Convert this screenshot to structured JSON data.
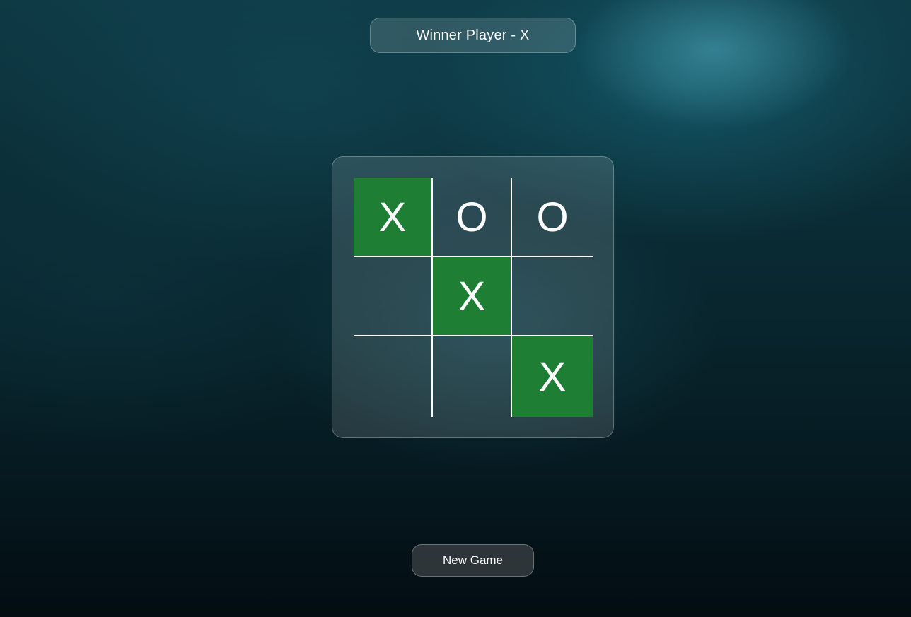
{
  "status": {
    "message": "Winner Player - X"
  },
  "board": {
    "cells": [
      "X",
      "O",
      "O",
      "",
      "X",
      "",
      "",
      "",
      "X"
    ],
    "winning_cells": [
      0,
      4,
      8
    ]
  },
  "controls": {
    "new_game_label": "New Game"
  },
  "colors": {
    "win_highlight": "#1e7f34",
    "grid_lines": "#ffffff",
    "text": "#ffffff"
  }
}
